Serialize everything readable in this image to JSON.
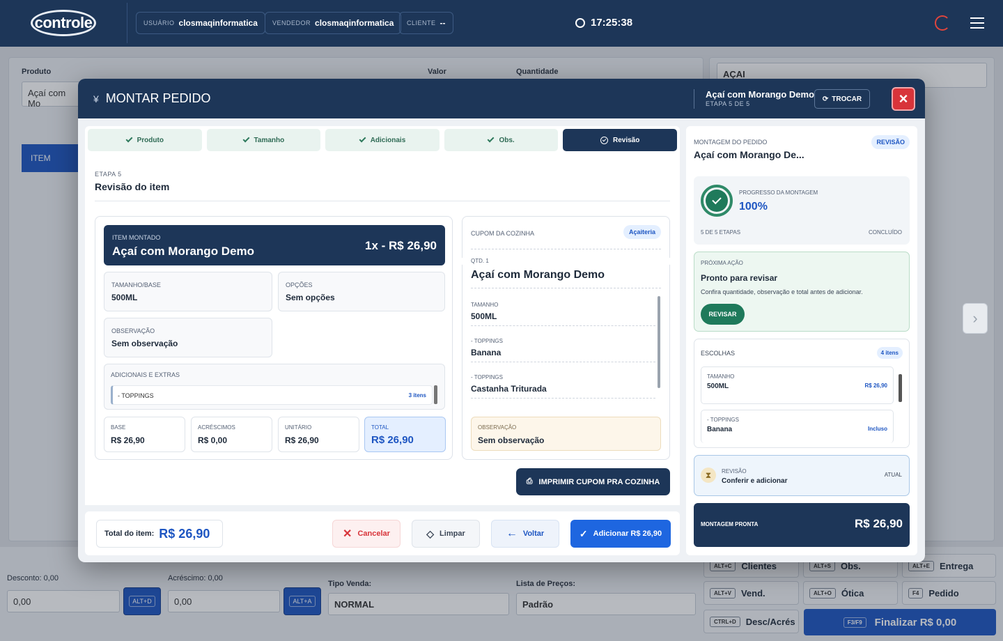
{
  "topbar": {
    "logo": "controle",
    "user_label": "USUÁRIO",
    "user_value": "closmaqinformatica",
    "seller_label": "VENDEDOR",
    "seller_value": "closmaqinformatica",
    "client_label": "CLIENTE",
    "client_value": "--",
    "clock": "17:25:38"
  },
  "background": {
    "product_label": "Produto",
    "product_value": "Açaí com Mo",
    "value_label": "Valor",
    "qty_label": "Quantidade",
    "category_select": "AÇAI",
    "table_header": "ITEM",
    "discount_label": "Desconto: 0,00",
    "discount_value": "0,00",
    "discount_key": "ALT+D",
    "surcharge_label": "Acréscimo: 0,00",
    "surcharge_value": "0,00",
    "surcharge_key": "ALT+A",
    "sale_type_label": "Tipo Venda:",
    "sale_type_value": "NORMAL",
    "price_list_label": "Lista de Preços:",
    "price_list_value": "Padrão",
    "shortcuts": [
      {
        "key": "ALT+C",
        "label": "Clientes"
      },
      {
        "key": "ALT+S",
        "label": "Obs."
      },
      {
        "key": "ALT+E",
        "label": "Entrega"
      },
      {
        "key": "ALT+V",
        "label": "Vend."
      },
      {
        "key": "ALT+O",
        "label": "Ótica"
      },
      {
        "key": "F4",
        "label": "Pedido"
      },
      {
        "key": "CTRL+D",
        "label": "Desc/Acrés"
      }
    ],
    "finalize_key": "F3/F9",
    "finalize_label": "Finalizar R$ 0,00"
  },
  "modal": {
    "title": "MONTAR PEDIDO",
    "product": "Açaí com Morango Demo",
    "step_info": "ETAPA 5 DE 5",
    "swap_label": "TROCAR",
    "close_label": "×",
    "steps": [
      "Produto",
      "Tamanho",
      "Adicionais",
      "Obs.",
      "Revisão"
    ],
    "review": {
      "etapa": "ETAPA 5",
      "title": "Revisão do item",
      "item_label": "ITEM MONTADO",
      "item_name": "Açaí com Morango Demo",
      "item_price": "1x - R$ 26,90",
      "size_label": "TAMANHO/BASE",
      "size_value": "500ML",
      "options_label": "OPÇÕES",
      "options_value": "Sem opções",
      "obs_label": "OBSERVAÇÃO",
      "obs_value": "Sem observação",
      "extras_label": "ADICIONAIS E EXTRAS",
      "extras_row": "- TOPPINGS",
      "extras_count": "3 itens",
      "base_label": "BASE",
      "base_value": "R$ 26,90",
      "add_label": "ACRÉSCIMOS",
      "add_value": "R$ 0,00",
      "unit_label": "UNITÁRIO",
      "unit_value": "R$ 26,90",
      "total_label": "TOTAL",
      "total_value": "R$ 26,90"
    },
    "coupon": {
      "label": "CUPOM DA COZINHA",
      "badge": "Açaiteria",
      "qty": "QTD. 1",
      "name": "Açaí com Morango Demo",
      "lines": [
        {
          "k": "TAMANHO",
          "v": "500ML"
        },
        {
          "k": "- TOPPINGS",
          "v": "Banana"
        },
        {
          "k": "- TOPPINGS",
          "v": "Castanha Triturada"
        }
      ],
      "obs_label": "OBSERVAÇÃO",
      "obs_value": "Sem observação",
      "print_label": "IMPRIMIR CUPOM PRA COZINHA"
    },
    "footer": {
      "total_label": "Total do item:",
      "total_value": "R$ 26,90",
      "cancel": "Cancelar",
      "clear": "Limpar",
      "back": "Voltar",
      "add": "Adicionar R$ 26,90"
    },
    "side": {
      "label": "MONTAGEM DO PEDIDO",
      "name": "Açaí com Morango De...",
      "badge": "REVISÃO",
      "progress_label": "PROGRESSO DA MONTAGEM",
      "progress_value": "100%",
      "steps_done": "5 DE 5 ETAPAS",
      "status": "CONCLUÍDO",
      "next_label": "PRÓXIMA AÇÃO",
      "next_title": "Pronto para revisar",
      "next_desc": "Confira quantidade, observação e total antes de adicionar.",
      "next_button": "REVISAR",
      "choices_label": "ESCOLHAS",
      "choices_count": "4 itens",
      "choices": [
        {
          "k": "TAMANHO",
          "v": "500ML",
          "p": "R$ 26,90"
        },
        {
          "k": "- TOPPINGS",
          "v": "Banana",
          "p": "Incluso"
        }
      ],
      "current_label": "REVISÃO",
      "current_title": "Conferir e adicionar",
      "current_tag": "ATUAL",
      "ready_label": "MONTAGEM PRONTA",
      "ready_value": "R$ 26,90"
    }
  },
  "colors": {
    "navy": "#1d3658",
    "blue": "#1e56c2",
    "green": "#1f7a5b",
    "red": "#d8343a"
  }
}
